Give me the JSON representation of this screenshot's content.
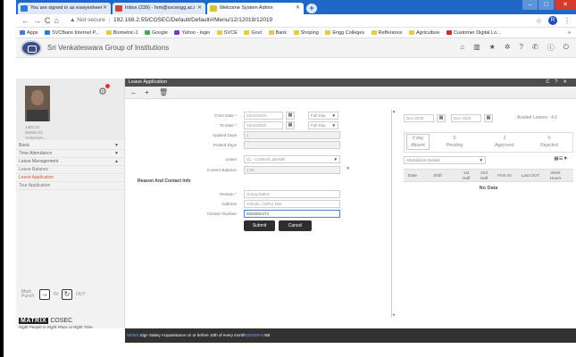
{
  "browser": {
    "tabs": [
      {
        "title": "You are signed in as eswyesheer",
        "favicon_color": "#2b7be0",
        "active": false
      },
      {
        "title": "Inbox (239) - hrm@svcengg.ac.i",
        "favicon_color": "#d0453a",
        "active": false
      },
      {
        "title": "Welcome System Admin",
        "favicon_color": "#d9c23a",
        "active": true
      }
    ],
    "security_label": "Not secure",
    "url": "192.168.2.55/COSEC/Default/Default#/Menu/12/12019/12019",
    "profile_initial": "R",
    "bookmarks": [
      {
        "label": "Apps",
        "color": "#4a7ad6"
      },
      {
        "label": "SVCBans Internet P...",
        "color": "#2b7be0"
      },
      {
        "label": "Biometric-1",
        "color": "#e8c74d"
      },
      {
        "label": "Google",
        "color": "#4aa854"
      },
      {
        "label": "Yahoo - login",
        "color": "#7c3cbf"
      },
      {
        "label": "SVCE",
        "color": "#e8c74d"
      },
      {
        "label": "Govt",
        "color": "#e8c74d"
      },
      {
        "label": "Bank",
        "color": "#e8c74d"
      },
      {
        "label": "Shoping",
        "color": "#e8c74d"
      },
      {
        "label": "Engg Colleges",
        "color": "#e8c74d"
      },
      {
        "label": "Refferance",
        "color": "#e8c74d"
      },
      {
        "label": "Agriculture",
        "color": "#e8c74d"
      },
      {
        "label": "Customer Digital Lo...",
        "color": "#c8302c"
      }
    ],
    "bookmarks_more": "»"
  },
  "app": {
    "org_name": "Sri Venkateswara Group of Institutions"
  },
  "sidebar": {
    "profile_lines": [
      "14EC10",
      "04333-XX",
      "YADHAVA..."
    ],
    "menu": [
      {
        "label": "Basic",
        "caret": "▼",
        "sub": false,
        "selected": false
      },
      {
        "label": "Time Attendance",
        "caret": "▼",
        "sub": false,
        "selected": false
      },
      {
        "label": "Leave Management",
        "caret": "▲",
        "sub": false,
        "selected": false
      },
      {
        "label": "Leave Balance",
        "caret": "",
        "sub": true,
        "selected": false
      },
      {
        "label": "Leave Application",
        "caret": "",
        "sub": true,
        "selected": true
      },
      {
        "label": "Tour Application",
        "caret": "",
        "sub": true,
        "selected": false
      }
    ],
    "punch_label": "Mark Punch",
    "in_label": "IN",
    "out_label": "OUT",
    "brand": "MATRIX",
    "brand_product": "COSEC",
    "tagline": "Right People in Right Place at Right Time"
  },
  "main": {
    "title": "Leave Application",
    "form": {
      "from_date_label": "From Date *",
      "from_date": "18/11/2020",
      "from_day": "Full Day",
      "to_date_label": "To Date *",
      "to_date": "18/11/2020",
      "to_day": "Full Day",
      "applied_days_label": "Applied Days",
      "applied_days": "1",
      "posted_days_label": "Posted Days",
      "posted_days": "",
      "leave_label": "Leave",
      "leave_value": "CL - CASUAL LEAVE",
      "balance_label": "Current Balance",
      "balance_value": "2.00",
      "expander": "»",
      "section_title": "Reason And Contact Info",
      "reason_label": "Reason *",
      "reason_value": "Going Native",
      "address_label": "Address",
      "address_value": "Yellodu, CBPur Dist",
      "contact_label": "Contact Number",
      "contact_value": "9845882474",
      "submit_label": "Submit",
      "cancel_label": "Cancel"
    },
    "right": {
      "range_from": "Dec 2020",
      "range_to": "Dec 2020",
      "availed_leaves": "Availed Leaves : 4.0",
      "stats": [
        {
          "value": "0 day",
          "label": "Absent"
        },
        {
          "value": "0",
          "label": "Pending"
        },
        {
          "value": "2",
          "label": "Approved"
        },
        {
          "value": "0",
          "label": "Rejected"
        }
      ],
      "filter": "Attendance Details",
      "columns": [
        "Date",
        "Shift",
        "1st Half",
        "2nd Half",
        "First IN",
        "Last OUT",
        "Work Hours"
      ],
      "empty_text": "No Data"
    }
  },
  "statusbar": {
    "prefix": "NEWS:",
    "message": "Sign Salary Acquaintance on or before 10th of every month",
    "tag": "GENERAL",
    "suffix": "NB"
  }
}
